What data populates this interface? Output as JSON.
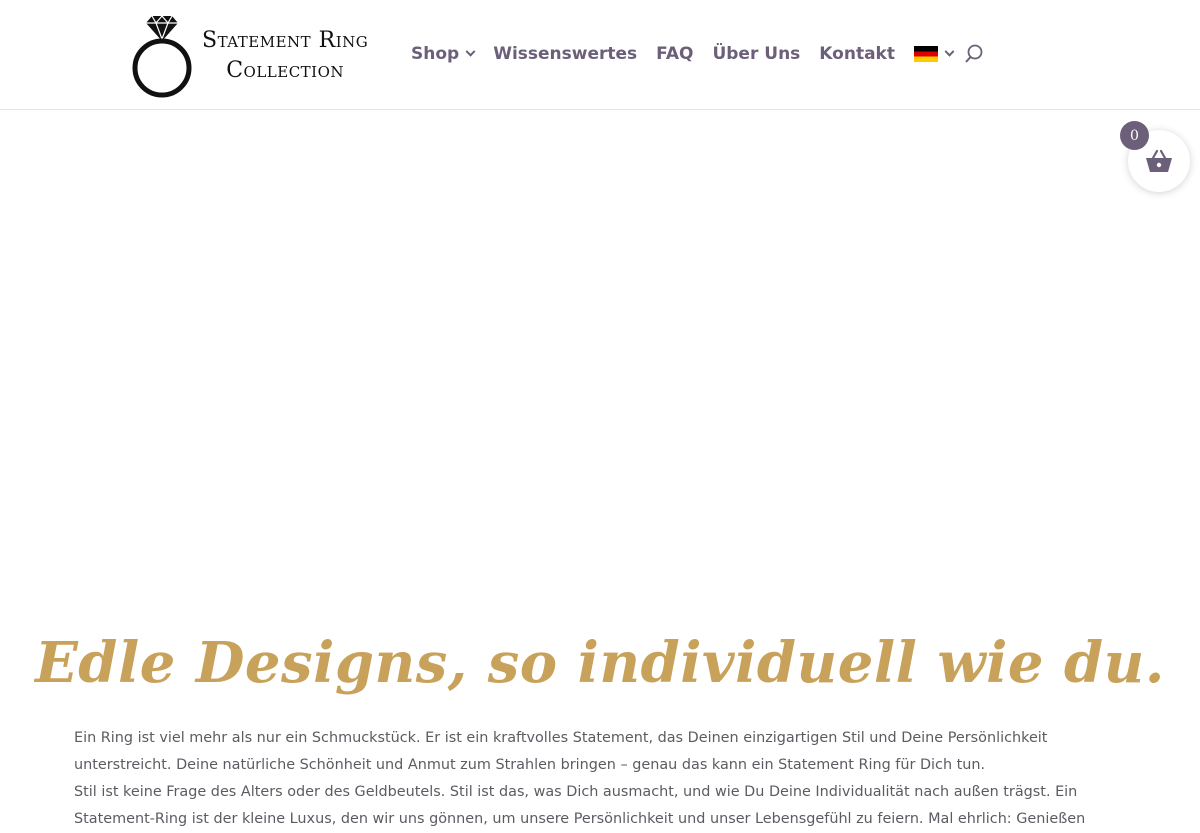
{
  "logo": {
    "line1": "Statement Ring",
    "line2": "Collection",
    "icon": "diamond-ring-icon"
  },
  "nav": {
    "shop": "Shop",
    "wissenswertes": "Wissenswertes",
    "faq": "FAQ",
    "ueber_uns": "Über Uns",
    "kontakt": "Kontakt",
    "language_icon": "german-flag-icon",
    "search_icon": "search-icon"
  },
  "cart": {
    "count": "0",
    "icon": "basket-icon"
  },
  "colors": {
    "nav": "#6b5f7a",
    "headline": "#c8a25a",
    "body": "#5e5a62",
    "badge": "#6b5f7a"
  },
  "content": {
    "headline": "Edle Designs, so individuell wie du.",
    "paragraph1": "Ein Ring ist viel mehr als nur ein Schmuckstück. Er ist ein kraftvolles Statement, das Deinen einzigartigen Stil und Deine Persönlichkeit unterstreicht. Deine natürliche Schönheit und Anmut zum Strahlen bringen – genau das kann ein Statement Ring für Dich tun.",
    "paragraph2": "Stil ist keine Frage des Alters oder des Geldbeutels. Stil ist das, was Dich ausmacht, und wie Du Deine Individualität nach außen trägst. Ein Statement-Ring ist der kleine Luxus, den wir uns gönnen, um unsere Persönlichkeit und unser Lebensgefühl zu feiern. Mal ehrlich: Genießen"
  }
}
